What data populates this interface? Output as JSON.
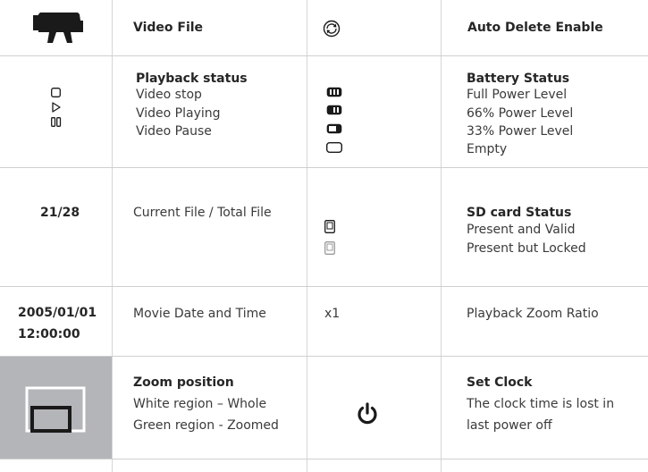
{
  "row1": {
    "video_file_label": "Video File",
    "auto_delete_label": "Auto Delete Enable"
  },
  "row2": {
    "playback_title": "Playback status",
    "playback_items": [
      "Video stop",
      "Video Playing",
      "Video Pause"
    ],
    "battery_title": "Battery Status",
    "battery_items": [
      "Full Power Level",
      "66% Power Level",
      "33% Power Level",
      "Empty"
    ]
  },
  "row3": {
    "file_counter": "21/28",
    "file_counter_desc": "Current File / Total File",
    "sd_title": "SD card Status",
    "sd_items": [
      "Present and Valid",
      "Present but Locked"
    ]
  },
  "row4": {
    "date": "2005/01/01",
    "time": "12:00:00",
    "date_desc": "Movie Date and Time",
    "zoom_ratio": "x1",
    "zoom_ratio_desc": "Playback Zoom Ratio"
  },
  "row5": {
    "zoom_title": "Zoom position",
    "zoom_items": [
      "White region – Whole",
      "Green region - Zoomed"
    ],
    "clock_title": "Set Clock",
    "clock_lines": [
      "The clock time is lost in",
      "last power off"
    ]
  },
  "colors": {
    "zoom_panel_bg": "#b4b5b9",
    "icon_dark": "#1a1a1a"
  },
  "icons": {
    "video_camera": "video-camera-icon",
    "auto_delete": "rotate-arrows-icon",
    "stop": "stop-icon",
    "play": "play-icon",
    "pause": "pause-icon",
    "battery": "battery-icon",
    "sd_card": "sd-card-icon",
    "power": "power-icon"
  }
}
